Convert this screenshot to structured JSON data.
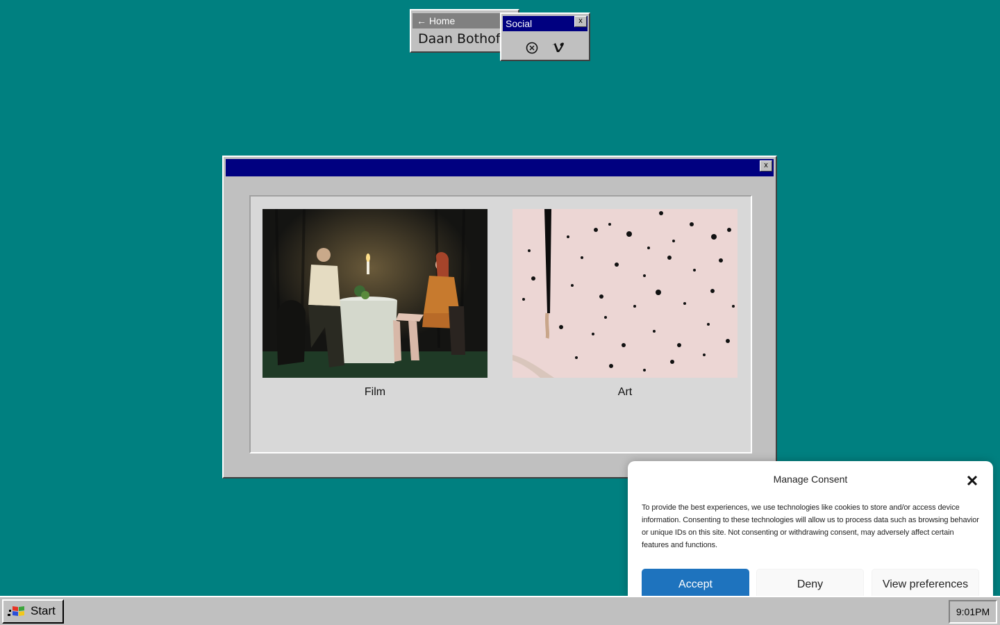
{
  "home_window": {
    "nav_label": "← Home",
    "site_name": "Daan Bothof"
  },
  "social_window": {
    "title": "Social",
    "close_label": "x",
    "icons": [
      "unsplash-icon",
      "vimeo-icon"
    ]
  },
  "main_window": {
    "close_label": "x",
    "tiles": [
      {
        "label": "Film",
        "image": "candlelit-dinner-photo"
      },
      {
        "label": "Art",
        "image": "ink-splatter-artwork"
      }
    ]
  },
  "consent": {
    "title": "Manage Consent",
    "body": "To provide the best experiences, we use technologies like cookies to store and/or access device information. Consenting to these technologies will allow us to process data such as browsing behavior or unique IDs on this site. Not consenting or withdrawing consent, may adversely affect certain features and functions.",
    "accept_label": "Accept",
    "deny_label": "Deny",
    "preferences_label": "View preferences",
    "accent_color": "#1e73be"
  },
  "taskbar": {
    "start_label": "Start",
    "clock": "9:01PM"
  },
  "colors": {
    "desktop": "#008080",
    "title_active": "#000080",
    "title_inactive": "#808080",
    "face": "#c0c0c0"
  }
}
